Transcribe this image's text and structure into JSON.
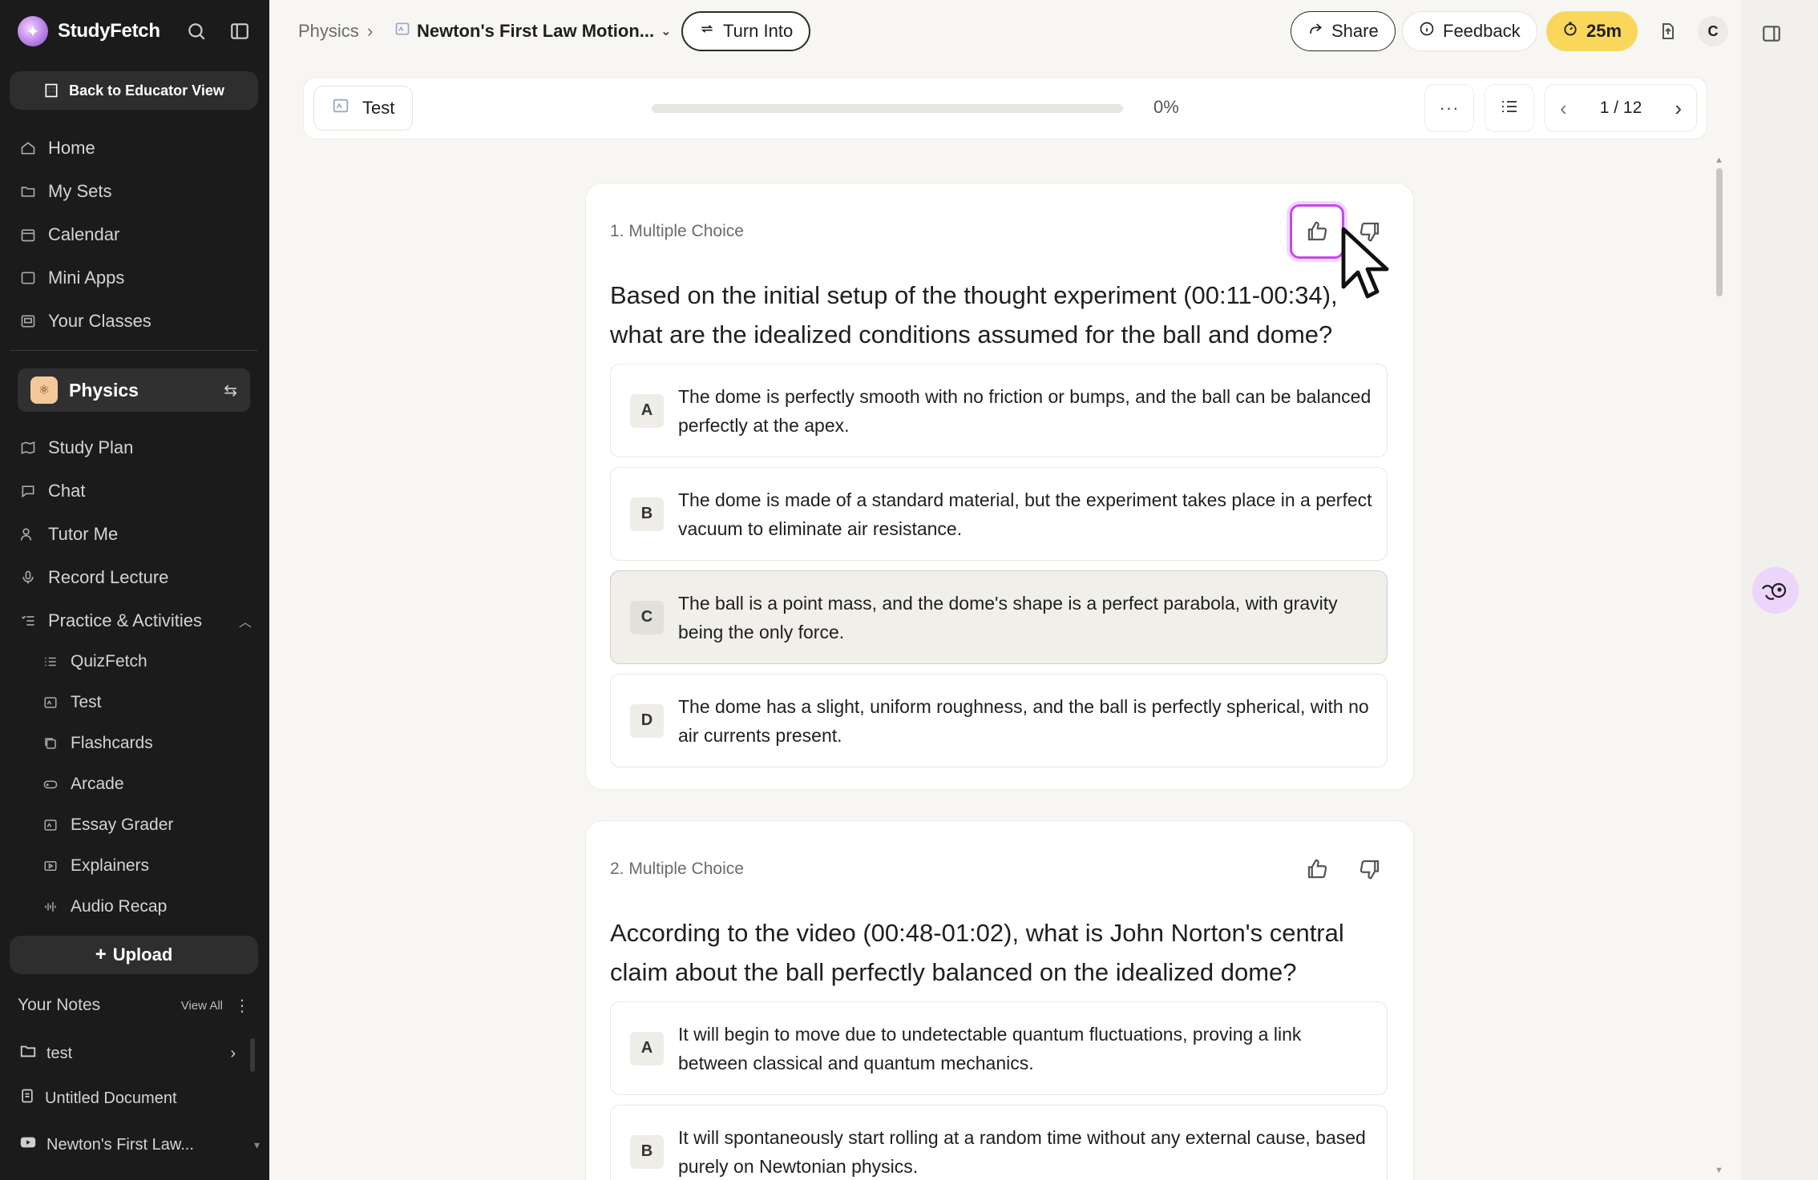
{
  "sidebar": {
    "brand": "StudyFetch",
    "back_button": "Back to Educator View",
    "nav": [
      "Home",
      "My Sets",
      "Calendar",
      "Mini Apps",
      "Your Classes"
    ],
    "current_class": "Physics",
    "class_nav": [
      "Study Plan",
      "Chat",
      "Tutor Me",
      "Record Lecture"
    ],
    "practice_label": "Practice & Activities",
    "practice_items": [
      "QuizFetch",
      "Test",
      "Flashcards",
      "Arcade",
      "Essay Grader",
      "Explainers",
      "Audio Recap"
    ],
    "upload_label": "Upload",
    "notes_title": "Your Notes",
    "notes_view_all": "View All",
    "notes": [
      "test",
      "Untitled Document",
      "Newton's First Law..."
    ]
  },
  "topbar": {
    "breadcrumb_root": "Physics",
    "breadcrumb_title": "Newton's First Law Motion...",
    "turn_into": "Turn Into",
    "share": "Share",
    "feedback": "Feedback",
    "timer": "25m",
    "avatar_initial": "C"
  },
  "test_bar": {
    "tab_label": "Test",
    "progress_text": "0%",
    "progress_value": 0,
    "pager_text": "1 / 12"
  },
  "questions": [
    {
      "type": "1. Multiple Choice",
      "text": "Based on the initial setup of the thought experiment (00:11-00:34), what are the idealized conditions assumed for the ball and dome?",
      "options": [
        {
          "letter": "A",
          "text": "The dome is perfectly smooth with no friction or bumps, and the ball can be balanced perfectly at the apex."
        },
        {
          "letter": "B",
          "text": "The dome is made of a standard material, but the experiment takes place in a perfect vacuum to eliminate air resistance."
        },
        {
          "letter": "C",
          "text": "The ball is a point mass, and the dome's shape is a perfect parabola, with gravity being the only force."
        },
        {
          "letter": "D",
          "text": "The dome has a slight, uniform roughness, and the ball is perfectly spherical, with no air currents present."
        }
      ]
    },
    {
      "type": "2. Multiple Choice",
      "text": "According to the video (00:48-01:02), what is John Norton's central claim about the ball perfectly balanced on the idealized dome?",
      "options": [
        {
          "letter": "A",
          "text": "It will begin to move due to undetectable quantum fluctuations, proving a link between classical and quantum mechanics."
        },
        {
          "letter": "B",
          "text": "It will spontaneously start rolling at a random time without any external cause, based purely on Newtonian physics."
        }
      ]
    }
  ],
  "colors": {
    "sidebar_bg": "#1b1b1b",
    "accent_vote": "#c34be6",
    "timer_bg": "#f8d75a",
    "selected_option_bg": "#f1efea"
  }
}
